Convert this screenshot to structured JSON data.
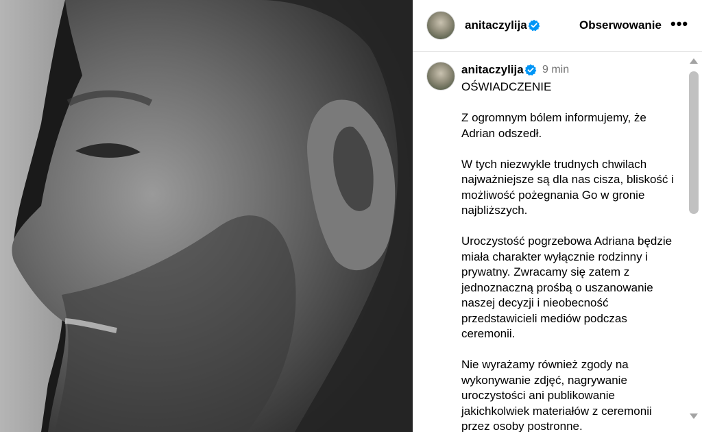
{
  "post": {
    "photo_alt": "black and white profile portrait"
  },
  "header": {
    "username": "anitaczylija",
    "follow_label": "Obserwowanie",
    "more_label": "•••"
  },
  "caption": {
    "username": "anitaczylija",
    "time": "9 min",
    "text": "OŚWIADCZENIE\n\nZ ogromnym bólem informujemy, że Adrian odszedł.\n\nW tych niezwykle trudnych chwilach najważniejsze są dla nas cisza, bliskość i możliwość pożegnania Go w gronie najbliższych.\n\nUroczystość pogrzebowa Adriana będzie miała charakter wyłącznie rodzinny i prywatny. Zwracamy się zatem z jednoznaczną prośbą o uszanowanie naszej decyzji i nieobecność przedstawicieli mediów podczas ceremonii.\n\nNie wyrażamy również zgody na wykonywanie zdjęć, nagrywanie uroczystości ani publikowanie jakichkolwiek materiałów z ceremonii przez osoby postronne."
  },
  "colors": {
    "verified": "#0095f6",
    "muted": "#737373",
    "border": "#dbdbdb"
  }
}
